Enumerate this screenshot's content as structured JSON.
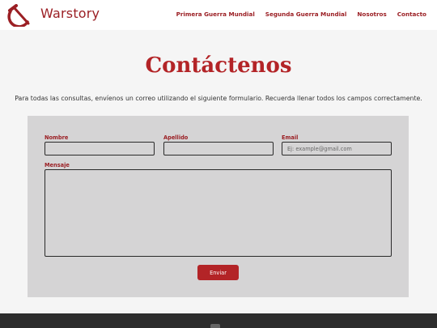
{
  "header": {
    "brand": "Warstory",
    "logo_icon": "hammer-sickle-icon",
    "nav": [
      "Primera Guerra Mundial",
      "Segunda Guerra Mundial",
      "Nosotros",
      "Contacto"
    ]
  },
  "main": {
    "title": "Contáctenos",
    "intro": "Para todas las consultas, envíenos un correo utilizando el siguiente formulario. Recuerda llenar todos los campos correctamente."
  },
  "form": {
    "nombre_label": "Nombre",
    "nombre_value": "",
    "apellido_label": "Apellido",
    "apellido_value": "",
    "email_label": "Email",
    "email_placeholder": "Ej: example@gmail.com",
    "email_value": "",
    "mensaje_label": "Mensaje",
    "mensaje_value": "",
    "submit_label": "Enviar"
  },
  "colors": {
    "brand": "#9b1f24",
    "accent": "#b32427",
    "form_background": "#d5d4d5",
    "footer_background": "#2d2d2d"
  }
}
